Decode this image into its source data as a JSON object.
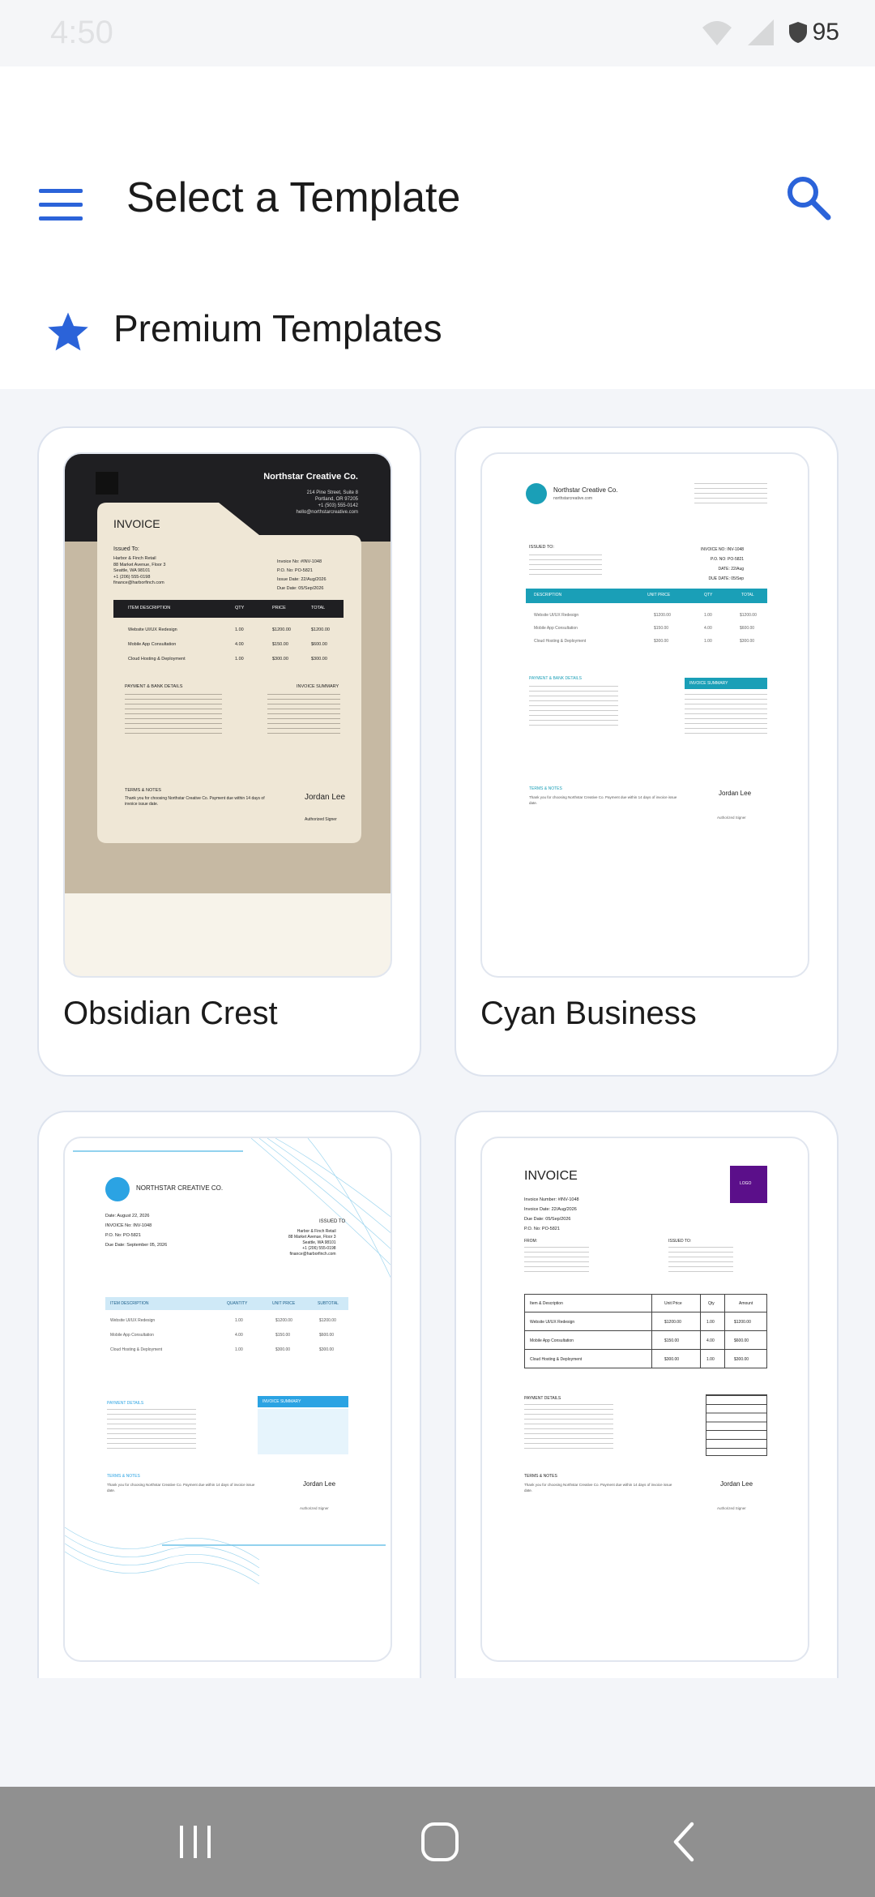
{
  "status_bar": {
    "time": "4:50",
    "battery": "95"
  },
  "header": {
    "title": "Select a Template"
  },
  "section": {
    "title": "Premium Templates"
  },
  "colors": {
    "accent": "#2b63d9",
    "cyan": "#1a9fb7",
    "purple": "#5b0f8a",
    "nav_bg": "#909090"
  },
  "icons": {
    "menu": "menu-icon",
    "search": "search-icon",
    "star": "star-icon"
  },
  "templates": [
    {
      "name": "Obsidian Crest",
      "preview": {
        "company": "Northstar Creative Co.",
        "address": [
          "214 Pine Street, Suite 8",
          "Portland, OR 97205",
          "+1 (503) 555-0142",
          "hello@northstarcreative.com"
        ],
        "heading": "INVOICE",
        "issued_to": "Issued To:",
        "client": [
          "Harbor & Finch Retail",
          "88 Market Avenue, Floor 3",
          "Seattle, WA 98101",
          "+1 (206) 555-0198",
          "finance@harborfinch.com"
        ],
        "meta": [
          "Invoice No: #INV-1048",
          "P.O. No: PO-5821",
          "Issue Date: 22/Aug/2026",
          "Due Date: 05/Sep/2026"
        ],
        "columns": [
          "ITEM DESCRIPTION",
          "QTY",
          "PRICE",
          "TOTAL"
        ],
        "rows": [
          [
            "Website UI/UX Redesign",
            "1.00",
            "$1200.00",
            "$1200.00"
          ],
          [
            "Mobile App Consultation",
            "4.00",
            "$150.00",
            "$600.00"
          ],
          [
            "Cloud Hosting & Deployment",
            "1.00",
            "$300.00",
            "$300.00"
          ]
        ],
        "payment_title": "PAYMENT & BANK DETAILS",
        "summary_title": "INVOICE SUMMARY",
        "terms_title": "TERMS & NOTES",
        "terms_text": "Thank you for choosing Northstar Creative Co. Payment due within 14 days of invoice issue date.",
        "signer": "Jordan Lee",
        "signer_role": "Authorized Signer"
      }
    },
    {
      "name": "Cyan Business",
      "preview": {
        "company": "Northstar Creative Co.",
        "site": "northstarcreative.com",
        "issued_to": "ISSUED TO:",
        "meta": [
          "INVOICE NO: INV-1048",
          "P.O. NO: PO-5821",
          "DATE: 22/Aug",
          "DUE DATE: 05/Sep"
        ],
        "columns": [
          "DESCRIPTION",
          "UNIT PRICE",
          "QTY",
          "TOTAL"
        ],
        "rows": [
          [
            "Website UI/UX Redesign",
            "$1200.00",
            "1.00",
            "$1200.00"
          ],
          [
            "Mobile App Consultation",
            "$150.00",
            "4.00",
            "$600.00"
          ],
          [
            "Cloud Hosting & Deployment",
            "$300.00",
            "1.00",
            "$300.00"
          ]
        ],
        "payment_title": "PAYMENT & BANK DETAILS",
        "summary_title": "INVOICE SUMMARY",
        "terms_title": "TERMS & NOTES",
        "terms_text": "Thank you for choosing Northstar Creative Co. Payment due within 14 days of invoice issue date.",
        "signer": "Jordan Lee",
        "signer_role": "Authorized Signer"
      }
    },
    {
      "name": "",
      "preview": {
        "company": "NORTHSTAR CREATIVE CO.",
        "meta": [
          "Date: August 22, 2026",
          "INVOICE No: INV-1048",
          "P.O. No: PO-5821",
          "Due Date: September 05, 2026"
        ],
        "issued_to": "ISSUED TO",
        "client": [
          "Harbor & Finch Retail",
          "88 Market Avenue, Floor 3",
          "Seattle, WA 98101",
          "+1 (206) 555-0198",
          "finance@harborfinch.com"
        ],
        "columns": [
          "ITEM DESCRIPTION",
          "QUANTITY",
          "UNIT PRICE",
          "SUBTOTAL"
        ],
        "rows": [
          [
            "Website UI/UX Redesign",
            "1.00",
            "$1200.00",
            "$1200.00"
          ],
          [
            "Mobile App Consultation",
            "4.00",
            "$150.00",
            "$600.00"
          ],
          [
            "Cloud Hosting & Deployment",
            "1.00",
            "$300.00",
            "$300.00"
          ]
        ],
        "payment_title": "PAYMENT DETAILS",
        "summary_title": "INVOICE SUMMARY",
        "terms_title": "TERMS & NOTES",
        "terms_text": "Thank you for choosing Northstar Creative Co. Payment due within 14 days of invoice issue date.",
        "signer": "Jordan Lee",
        "signer_role": "Authorized Signer"
      }
    },
    {
      "name": "",
      "preview": {
        "heading": "INVOICE",
        "logo": "LOGO",
        "meta": [
          "Invoice Number: #INV-1048",
          "Invoice Date: 22/Aug/2026",
          "Due Date: 05/Sep/2026",
          "P.O. No: PO-5821"
        ],
        "from": "FROM:",
        "issued_to": "ISSUED TO:",
        "columns": [
          "Item & Description",
          "Unit Price",
          "Qty",
          "Amount"
        ],
        "rows": [
          [
            "Website UI/UX Redesign",
            "$1200.00",
            "1.00",
            "$1200.00"
          ],
          [
            "Mobile App Consultation",
            "$150.00",
            "4.00",
            "$600.00"
          ],
          [
            "Cloud Hosting & Deployment",
            "$300.00",
            "1.00",
            "$300.00"
          ]
        ],
        "payment_title": "PAYMENT DETAILS",
        "terms_title": "TERMS & NOTES",
        "terms_text": "Thank you for choosing Northstar Creative Co. Payment due within 14 days of invoice issue date.",
        "signer": "Jordan Lee",
        "signer_role": "Authorized Signer"
      }
    }
  ]
}
